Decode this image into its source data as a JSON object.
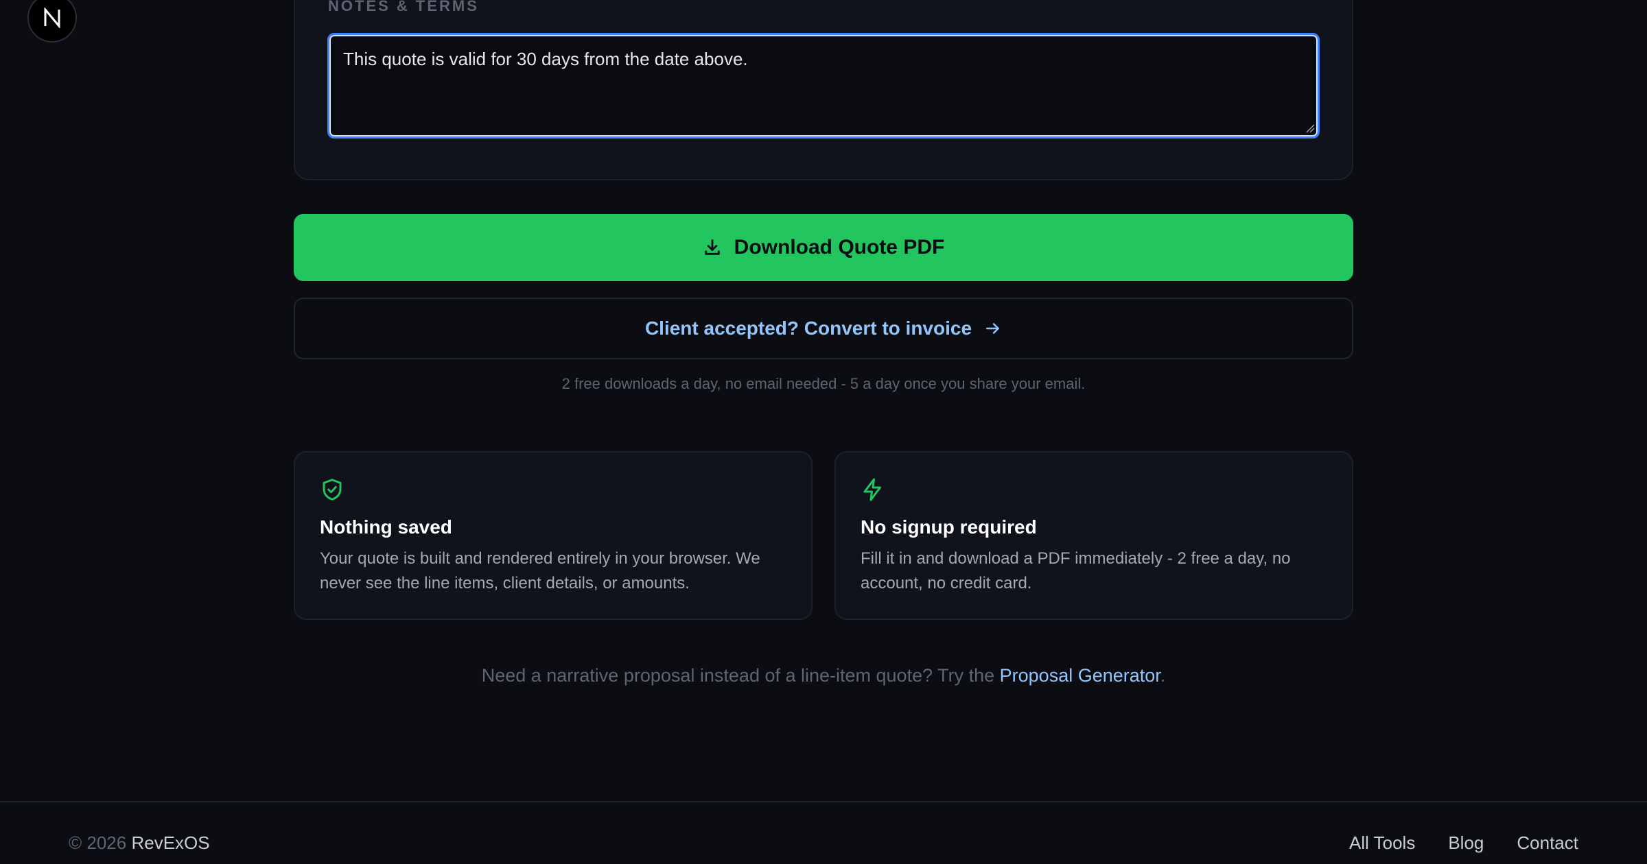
{
  "notes": {
    "label": "NOTES & TERMS",
    "value": "This quote is valid for 30 days from the date above."
  },
  "download": {
    "label": "Download Quote PDF",
    "icon": "download-icon"
  },
  "convert": {
    "label": "Client accepted? Convert to invoice",
    "icon": "arrow-right-icon"
  },
  "limits_note": "2 free downloads a day, no email needed - 5 a day once you share your email.",
  "features": [
    {
      "icon": "shield-check-icon",
      "title": "Nothing saved",
      "text": "Your quote is built and rendered entirely in your browser. We never see the line items, client details, or amounts."
    },
    {
      "icon": "lightning-icon",
      "title": "No signup required",
      "text": "Fill it in and download a PDF immediately - 2 free a day, no account, no credit card."
    }
  ],
  "proposal": {
    "prefix": "Need a narrative proposal instead of a line-item quote? Try the ",
    "link": "Proposal Generator",
    "suffix": "."
  },
  "footer": {
    "copyright": "© 2026 ",
    "brand": "RevExOS",
    "links": [
      "All Tools",
      "Blog",
      "Contact"
    ]
  },
  "colors": {
    "accent_green": "#22c55e",
    "link_blue": "#93c5fd",
    "focus_blue": "#3b82f6",
    "background": "#0b0d12"
  }
}
